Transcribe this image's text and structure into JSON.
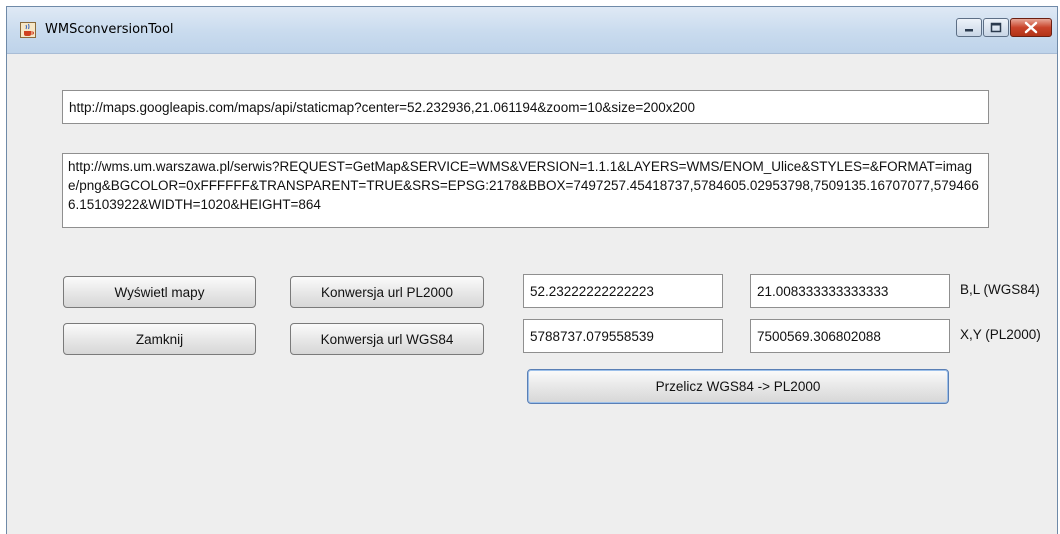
{
  "window": {
    "title": "WMSconversionTool",
    "icon": "java-cup-icon"
  },
  "window_controls": {
    "minimize_icon": "minimize-icon",
    "maximize_icon": "maximize-icon",
    "close_icon": "close-icon"
  },
  "fields": {
    "google_url": "http://maps.googleapis.com/maps/api/staticmap?center=52.232936,21.061194&zoom=10&size=200x200",
    "wms_url": "http://wms.um.warszawa.pl/serwis?REQUEST=GetMap&SERVICE=WMS&VERSION=1.1.1&LAYERS=WMS/ENOM_Ulice&STYLES=&FORMAT=image/png&BGCOLOR=0xFFFFFF&TRANSPARENT=TRUE&SRS=EPSG:2178&BBOX=7497257.45418737,5784605.02953798,7509135.16707077,5794666.15103922&WIDTH=1020&HEIGHT=864",
    "b_value": "52.23222222222223",
    "l_value": "21.008333333333333",
    "x_value": "5788737.079558539",
    "y_value": "7500569.306802088"
  },
  "labels": {
    "wgs84": "B,L (WGS84)",
    "pl2000": "X,Y (PL2000)"
  },
  "buttons": {
    "show_maps": "Wyświetl mapy",
    "close": "Zamknij",
    "convert_pl2000": "Konwersja url PL2000",
    "convert_wgs84": "Konwersja url WGS84",
    "recalc": "Przelicz WGS84 -> PL2000"
  }
}
